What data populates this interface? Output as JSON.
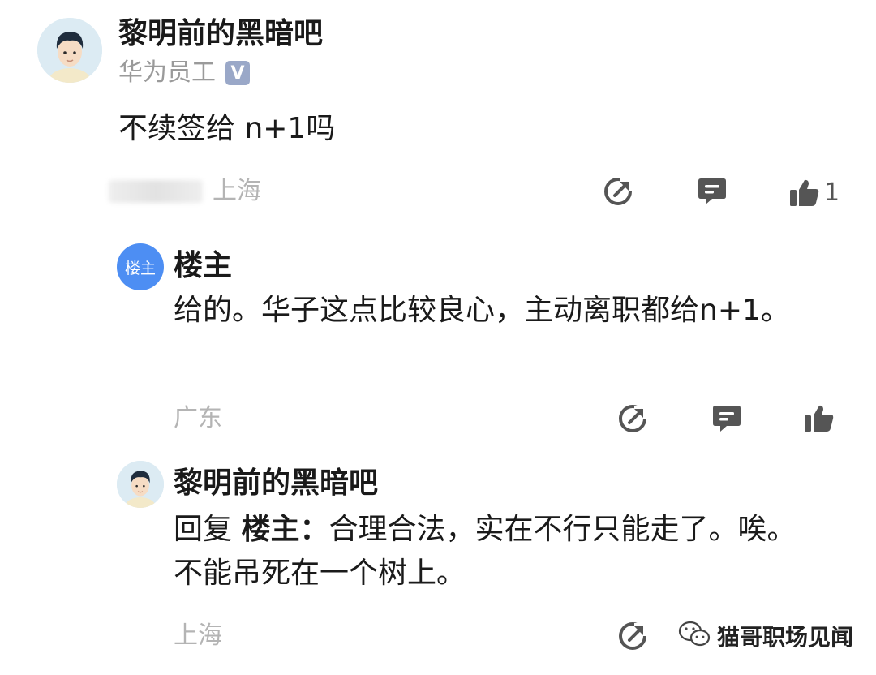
{
  "post": {
    "author": "黎明前的黑暗吧",
    "badge_text": "华为员工",
    "verified_icon": "V",
    "content": "不续签给 n+1吗",
    "location": "上海",
    "like_count": "1"
  },
  "replies": [
    {
      "avatar_text": "楼主",
      "author": "楼主",
      "content": "给的。华子这点比较良心，主动离职都给n+1。",
      "location": "广东"
    },
    {
      "author": "黎明前的黑暗吧",
      "reply_prefix": "回复",
      "reply_to": "楼主：",
      "content": "合理合法，实在不行只能走了。唉。不能吊死在一个树上。",
      "location": "上海"
    }
  ],
  "watermark": {
    "icon": "wechat-icon",
    "text": "猫哥职场见闻"
  },
  "colors": {
    "accent_blue": "#4d8ef3",
    "icon_dark": "#555555",
    "muted_text": "#b4b4b4"
  }
}
